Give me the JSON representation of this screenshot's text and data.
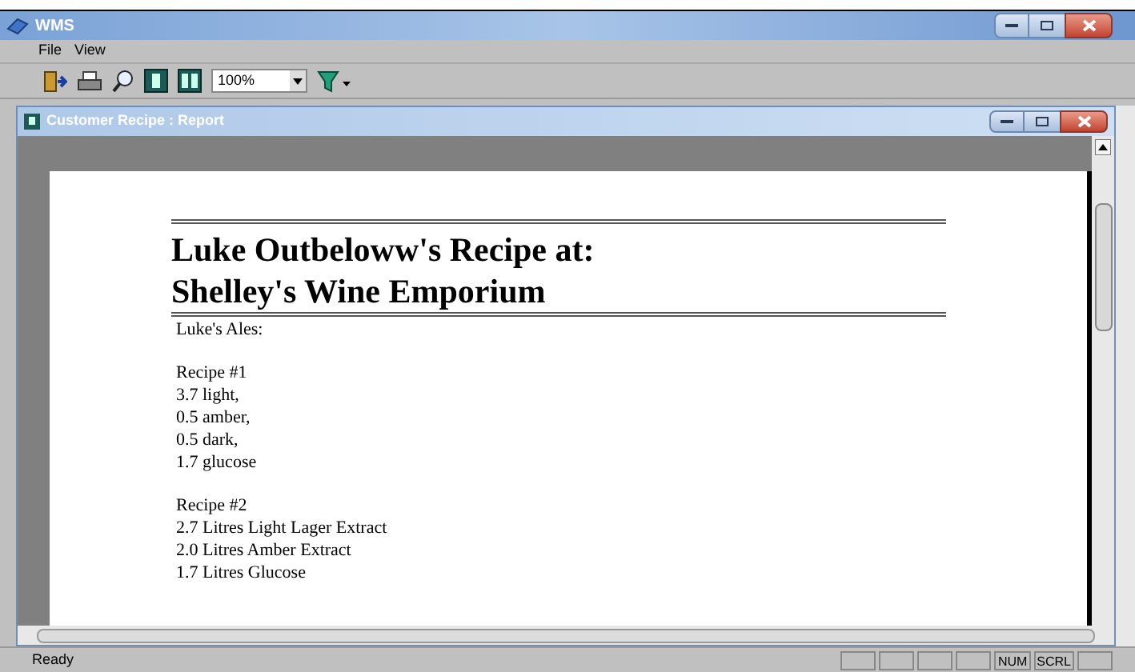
{
  "window": {
    "title": "WMS"
  },
  "menu": [
    "File",
    "View"
  ],
  "toolbar": {
    "zoom": "100%"
  },
  "child_window": {
    "title": "Customer Recipe : Report"
  },
  "report": {
    "heading": [
      "Luke Outbeloww's Recipe at:",
      "Shelley's Wine Emporium"
    ],
    "sections": [
      {
        "lines": [
          "Luke's Ales:"
        ]
      },
      {
        "lines": [
          "Recipe #1",
          "3.7 light,",
          "0.5 amber,",
          "0.5 dark,",
          "1.7 glucose"
        ]
      },
      {
        "lines": [
          "Recipe #2",
          "2.7 Litres Light Lager Extract",
          "2.0 Litres Amber Extract",
          "1.7 Litres Glucose"
        ]
      }
    ]
  },
  "status_bar": {
    "text": "Ready",
    "panes": [
      {
        "kind": "blank"
      },
      {
        "kind": "blank"
      },
      {
        "kind": "blank"
      },
      {
        "kind": "blank"
      },
      {
        "kind": "indicator",
        "label": "NUM"
      },
      {
        "kind": "indicator",
        "label": "SCRL"
      },
      {
        "kind": "blank"
      }
    ]
  }
}
